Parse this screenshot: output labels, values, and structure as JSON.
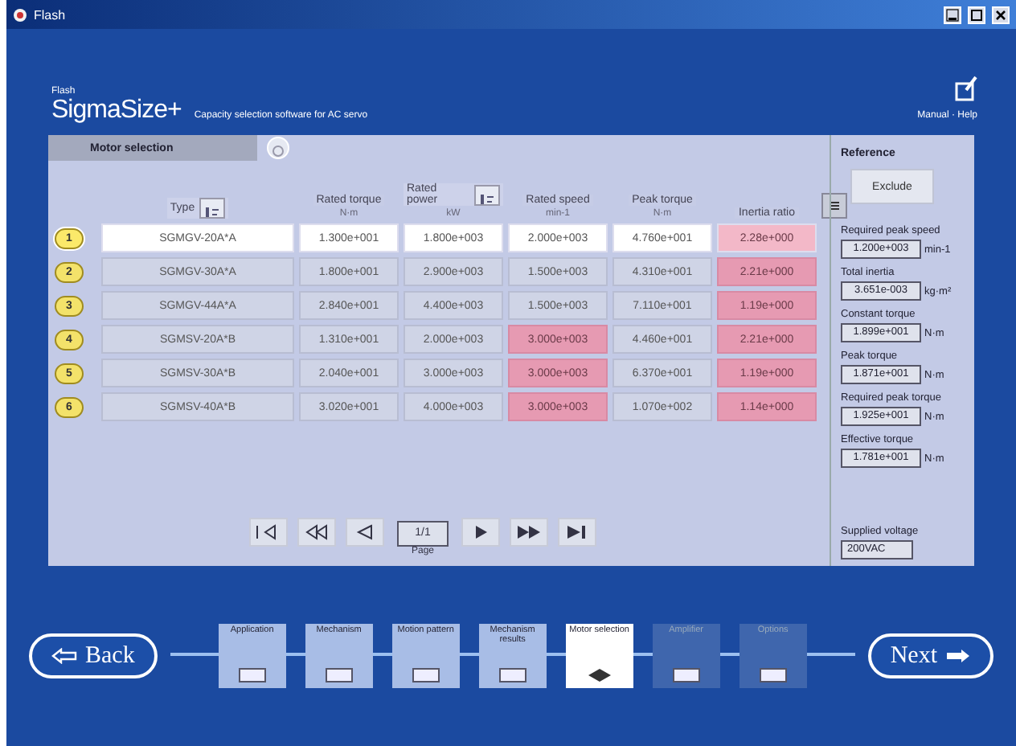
{
  "window": {
    "title": "Flash"
  },
  "header": {
    "overline": "Flash",
    "app_name": "SigmaSize+",
    "subtitle": "Capacity selection software for AC servo",
    "links": "Manual · Help"
  },
  "tab": {
    "label": "Motor selection",
    "selected": true
  },
  "table": {
    "columns": [
      {
        "label": "Type",
        "sortable": true
      },
      {
        "label": "Rated torque",
        "unit": "N·m",
        "sortable": false
      },
      {
        "label": "Rated power",
        "unit": "kW",
        "sortable": true
      },
      {
        "label": "Rated speed",
        "unit": "min-1",
        "sortable": false
      },
      {
        "label": "Peak torque",
        "unit": "N·m",
        "sortable": false
      },
      {
        "label": "Inertia ratio",
        "sortable": false
      }
    ],
    "rows": [
      {
        "number": "1",
        "selected": true,
        "cells": [
          {
            "text": "SGMGV-20A*A",
            "warn": false
          },
          {
            "text": "1.300e+001",
            "warn": false
          },
          {
            "text": "1.800e+003",
            "warn": false
          },
          {
            "text": "2.000e+003",
            "warn": false
          },
          {
            "text": "4.760e+001",
            "warn": false
          },
          {
            "text": "2.28e+000",
            "warn": true
          }
        ]
      },
      {
        "number": "2",
        "selected": false,
        "cells": [
          {
            "text": "SGMGV-30A*A",
            "warn": false
          },
          {
            "text": "1.800e+001",
            "warn": false
          },
          {
            "text": "2.900e+003",
            "warn": false
          },
          {
            "text": "1.500e+003",
            "warn": false
          },
          {
            "text": "4.310e+001",
            "warn": false
          },
          {
            "text": "2.21e+000",
            "warn": true
          }
        ]
      },
      {
        "number": "3",
        "selected": false,
        "cells": [
          {
            "text": "SGMGV-44A*A",
            "warn": false
          },
          {
            "text": "2.840e+001",
            "warn": false
          },
          {
            "text": "4.400e+003",
            "warn": false
          },
          {
            "text": "1.500e+003",
            "warn": false
          },
          {
            "text": "7.110e+001",
            "warn": false
          },
          {
            "text": "1.19e+000",
            "warn": true
          }
        ]
      },
      {
        "number": "4",
        "selected": false,
        "cells": [
          {
            "text": "SGMSV-20A*B",
            "warn": false
          },
          {
            "text": "1.310e+001",
            "warn": false
          },
          {
            "text": "2.000e+003",
            "warn": false
          },
          {
            "text": "3.000e+003",
            "warn": true
          },
          {
            "text": "4.460e+001",
            "warn": false
          },
          {
            "text": "2.21e+000",
            "warn": true
          }
        ]
      },
      {
        "number": "5",
        "selected": false,
        "cells": [
          {
            "text": "SGMSV-30A*B",
            "warn": false
          },
          {
            "text": "2.040e+001",
            "warn": false
          },
          {
            "text": "3.000e+003",
            "warn": false
          },
          {
            "text": "3.000e+003",
            "warn": true
          },
          {
            "text": "6.370e+001",
            "warn": false
          },
          {
            "text": "1.19e+000",
            "warn": true
          }
        ]
      },
      {
        "number": "6",
        "selected": false,
        "cells": [
          {
            "text": "SGMSV-40A*B",
            "warn": false
          },
          {
            "text": "3.020e+001",
            "warn": false
          },
          {
            "text": "4.000e+003",
            "warn": false
          },
          {
            "text": "3.000e+003",
            "warn": true
          },
          {
            "text": "1.070e+002",
            "warn": false
          },
          {
            "text": "1.14e+000",
            "warn": true
          }
        ]
      }
    ]
  },
  "pager": {
    "value": "1/1",
    "label": "Page"
  },
  "side_panel": {
    "heading": "Reference",
    "button": "Exclude",
    "fields": [
      {
        "label": "Required peak speed",
        "value": "1.200e+003",
        "unit": "min-1"
      },
      {
        "label": "Total inertia",
        "value": "3.651e-003",
        "unit": "kg·m²"
      },
      {
        "label": "Constant torque",
        "value": "1.899e+001",
        "unit": "N·m"
      },
      {
        "label": "Peak torque",
        "value": "1.871e+001",
        "unit": "N·m"
      },
      {
        "label": "Required peak torque",
        "value": "1.925e+001",
        "unit": "N·m"
      },
      {
        "label": "Effective torque",
        "value": "1.781e+001",
        "unit": "N·m"
      }
    ],
    "voltage": {
      "label": "Supplied voltage",
      "value": "200VAC"
    }
  },
  "wizard": {
    "back": "Back",
    "next": "Next",
    "steps": [
      {
        "label": "Application",
        "current": false,
        "enabled": true
      },
      {
        "label": "Mechanism",
        "current": false,
        "enabled": true
      },
      {
        "label": "Motion pattern",
        "current": false,
        "enabled": true
      },
      {
        "label": "Mechanism results",
        "current": false,
        "enabled": true
      },
      {
        "label": "Motor selection",
        "current": true,
        "enabled": true
      },
      {
        "label": "Amplifier",
        "current": false,
        "enabled": false
      },
      {
        "label": "Options",
        "current": false,
        "enabled": false
      }
    ]
  }
}
